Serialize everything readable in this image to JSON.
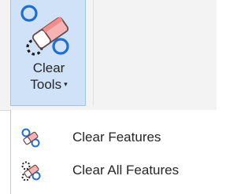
{
  "ribbon": {
    "clear_tools": {
      "line1": "Clear",
      "line2": "Tools",
      "caret": "▾",
      "icon": "eraser-with-shapes-icon"
    }
  },
  "menu": {
    "items": [
      {
        "label": "Clear Features",
        "icon": "clear-features-icon"
      },
      {
        "label": "Clear All Features",
        "icon": "clear-all-features-icon"
      }
    ]
  },
  "colors": {
    "accent_blue": "#1e6fd0",
    "eraser_pink": "#f08d8d",
    "button_highlight": "#cfe2f8"
  }
}
